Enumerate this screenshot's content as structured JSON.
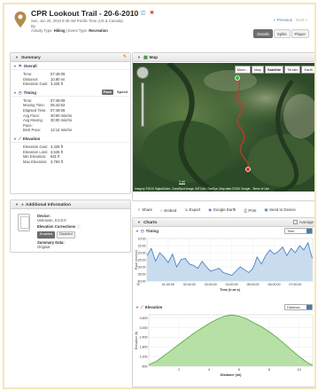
{
  "header": {
    "title": "CPR Lookout Trail - 20-6-2010",
    "datetime": "Sun, Jun 20, 2010 8:48 AM Pacific Time (US & Canada)",
    "by": "By",
    "activity_type_label": "Activity Type:",
    "activity_type": "Hiking",
    "event_type_label": "Event Type:",
    "event_type": "Recreation",
    "nav_previous": "« Previous",
    "nav_next": "Next »",
    "tabs": [
      "Details",
      "Splits",
      "Player"
    ]
  },
  "summary": {
    "title": "Summary",
    "overall": {
      "title": "Overall",
      "rows": [
        {
          "k": "Time:",
          "v": "07:49:09"
        },
        {
          "k": "Distance:",
          "v": "10.90 mi"
        },
        {
          "k": "Elevation Gain:",
          "v": "3,426 ft"
        }
      ]
    },
    "timing": {
      "title": "Timing",
      "pace_label": "Pace",
      "speed_label": "Speed",
      "rows": [
        {
          "k": "Time:",
          "v": "07:49:09"
        },
        {
          "k": "Moving Time:",
          "v": "05:43:52"
        },
        {
          "k": "Elapsed Time:",
          "v": "07:49:09"
        },
        {
          "k": "Avg Pace:",
          "v": "30:00 min/mi"
        },
        {
          "k": "Avg Moving Pace:",
          "v": "30:00 min/mi"
        },
        {
          "k": "Best Pace:",
          "v": "12:14 min/mi"
        }
      ]
    },
    "elevation": {
      "title": "Elevation",
      "rows": [
        {
          "k": "Elevation Gain:",
          "v": "3,426 ft"
        },
        {
          "k": "Elevation Loss:",
          "v": "3,545 ft"
        },
        {
          "k": "Min Elevation:",
          "v": "641 ft"
        },
        {
          "k": "Max Elevation:",
          "v": "3,793 ft"
        }
      ]
    }
  },
  "additional": {
    "title": "Additional Information",
    "device_label": "Device:",
    "device_value": "Unknown, 0.0.0.0",
    "corrections_label": "Elevation Corrections",
    "enabled_label": "Enabled",
    "disabled_label": "Disabled",
    "summary_data_label": "Summary Data:",
    "summary_data_value": "Original"
  },
  "map": {
    "title": "Map",
    "buttons": [
      "More...",
      "Map",
      "Satellite",
      "Terrain",
      "Earth"
    ],
    "scale": "1 mi",
    "copyright": "Imagery ©2010 DigitalGlobe, Cnes/Spot Image, IMTCAN, GeoEye, Map data ©2010 Google - Terms of Use"
  },
  "share": {
    "items": [
      "Share",
      "Embed",
      "Export",
      "Google Earth",
      "Print",
      "Send to Device"
    ]
  },
  "charts": {
    "title": "Charts",
    "average_label": "Average",
    "timing": {
      "title": "Timing",
      "select": "Time",
      "ylabel": "Pace (min/mi)",
      "xlabel": "Time (h:m:s)",
      "yticks": [
        "10:00",
        "15:00",
        "20:00",
        "25:00",
        "30:00",
        "35:00",
        "40:00"
      ],
      "xticks": [
        "01:00:00",
        "02:00:00",
        "03:00:00",
        "04:00:00",
        "05:00:00",
        "06:00:00",
        "07:00:00"
      ]
    },
    "elevation": {
      "title": "Elevation",
      "select": "Distance",
      "ylabel": "Elevation (ft)",
      "xlabel": "Distance (mi)",
      "yticks": [
        "3,600",
        "3,000",
        "2,400",
        "1,800",
        "1,200",
        "600"
      ],
      "xticks": [
        "2",
        "4",
        "6",
        "8",
        "10"
      ]
    }
  },
  "chart_data": [
    {
      "type": "area",
      "title": "",
      "xlabel": "Time (h:m:s)",
      "ylabel": "Pace (min/mi)",
      "y_reversed": true,
      "ylim": [
        10,
        40
      ],
      "xlim_hours": [
        0,
        7.82
      ],
      "x_hours": [
        0,
        0.2,
        0.4,
        0.6,
        0.8,
        1.0,
        1.2,
        1.4,
        1.6,
        1.8,
        2.0,
        2.2,
        2.4,
        2.6,
        2.8,
        3.0,
        3.2,
        3.4,
        3.6,
        3.8,
        4.0,
        4.2,
        4.4,
        4.6,
        4.8,
        5.0,
        5.2,
        5.4,
        5.6,
        5.8,
        6.0,
        6.2,
        6.4,
        6.6,
        6.8,
        7.0,
        7.2,
        7.4,
        7.6,
        7.8
      ],
      "pace": [
        22,
        17,
        26,
        20,
        23,
        27,
        21,
        30,
        25,
        24,
        28,
        29,
        31,
        26,
        30,
        33,
        32,
        31,
        34,
        35,
        36,
        33,
        30,
        32,
        34,
        31,
        23,
        28,
        22,
        18,
        21,
        19,
        16,
        22,
        17,
        20,
        15,
        18,
        13,
        24
      ]
    },
    {
      "type": "area",
      "title": "",
      "xlabel": "Distance (mi)",
      "ylabel": "Elevation (ft)",
      "ylim": [
        600,
        3800
      ],
      "xlim": [
        0,
        10.9
      ],
      "x": [
        0,
        0.5,
        1,
        1.5,
        2,
        2.5,
        3,
        3.5,
        4,
        4.5,
        5,
        5.5,
        6,
        6.5,
        7,
        7.5,
        8,
        8.5,
        9,
        9.5,
        10,
        10.5,
        10.9
      ],
      "elevation": [
        700,
        900,
        1250,
        1600,
        1950,
        2300,
        2650,
        2950,
        3250,
        3500,
        3700,
        3790,
        3720,
        3550,
        3300,
        3050,
        2750,
        2400,
        2000,
        1600,
        1200,
        850,
        650
      ]
    }
  ],
  "colors": {
    "link": "#4a79b0",
    "pace_fill": "#c8dcee",
    "pace_line": "#3f78c0",
    "elev_fill": "#b6e0a6",
    "elev_line": "#52a83c",
    "route": "#d0352a"
  }
}
